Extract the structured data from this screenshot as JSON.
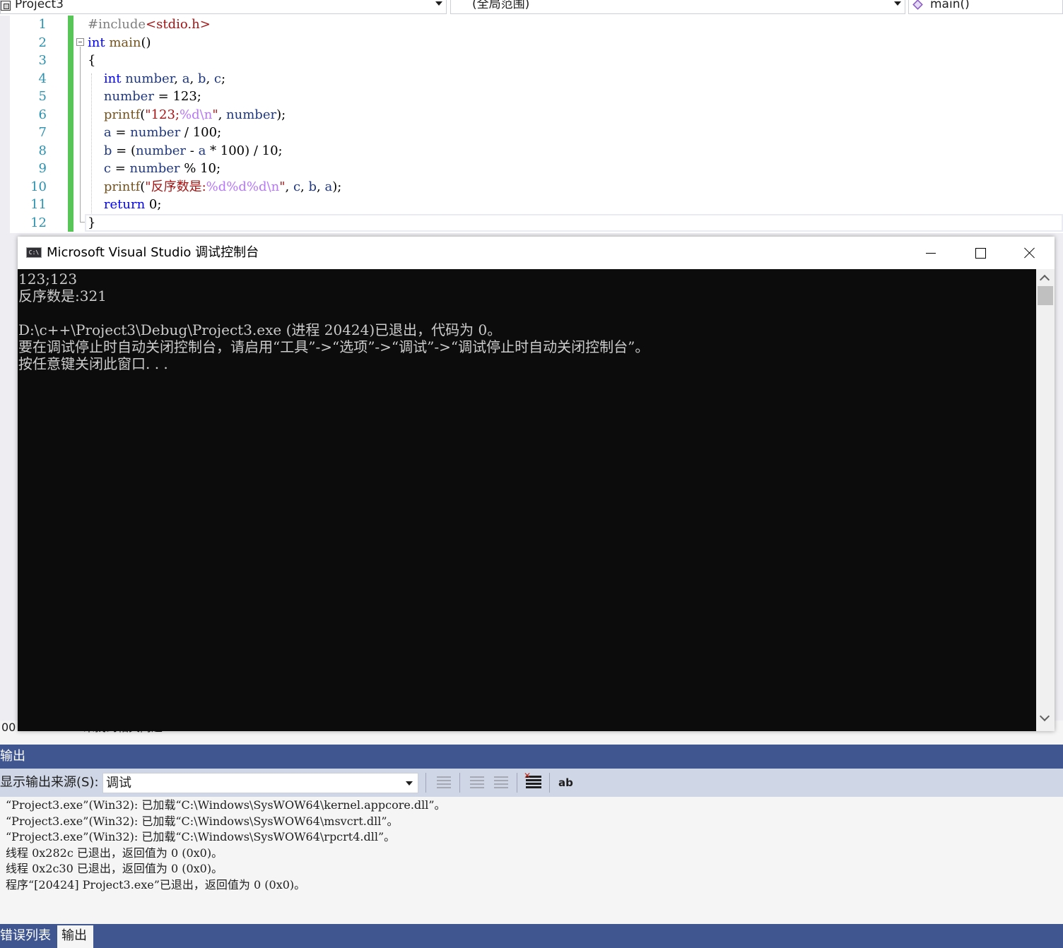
{
  "navbar": {
    "project": "Project3",
    "scope": "(全局范围)",
    "function": "main()"
  },
  "editor": {
    "line_numbers": [
      "1",
      "2",
      "3",
      "4",
      "5",
      "6",
      "7",
      "8",
      "9",
      "10",
      "11",
      "12"
    ],
    "code": {
      "l1": {
        "a": "#include",
        "b": "<stdio.h>"
      },
      "l2": {
        "a": "int",
        "b": " main",
        "c": "()"
      },
      "l3": {
        "a": "{"
      },
      "l4": {
        "a": "    int",
        "b": " number",
        "c": ", ",
        "d": "a",
        "e": ", ",
        "f": "b",
        "g": ", ",
        "h": "c",
        "i": ";"
      },
      "l5": {
        "a": "    number",
        "b": " = 123;"
      },
      "l6": {
        "a": "    printf",
        "b": "(",
        "c": "\"123;",
        "d": "%d",
        "e": "\\n",
        "f": "\"",
        "g": ", ",
        "h": "number",
        "i": ");"
      },
      "l7": {
        "a": "    a",
        "b": " = ",
        "c": "number",
        "d": " / 100;"
      },
      "l8": {
        "a": "    b",
        "b": " = (",
        "c": "number",
        "d": " - ",
        "e": "a",
        "f": " * 100) / 10;"
      },
      "l9": {
        "a": "    c",
        "b": " = ",
        "c": "number",
        "d": " % 10;"
      },
      "l10": {
        "a": "    printf",
        "b": "(",
        "c": "\"反序数是:",
        "d": "%d%d%d",
        "e": "\\n",
        "f": "\"",
        "g": ", ",
        "h": "c",
        "i": ", ",
        "j": "b",
        "k": ", ",
        "l": "a",
        "m": ");"
      },
      "l11": {
        "a": "    return",
        "b": " 0;"
      },
      "l12": {
        "a": "}"
      }
    }
  },
  "console": {
    "icon_text": "C:\\",
    "title": "Microsoft Visual Studio 调试控制台",
    "lines": [
      "123;123",
      "反序数是:321",
      "",
      "D:\\c++\\Project3\\Debug\\Project3.exe (进程 20424)已退出，代码为 0。",
      "要在调试停止时自动关闭控制台，请启用“工具”->“选项”->“调试”->“调试停止时自动关闭控制台”。",
      "按任意键关闭此窗口. . ."
    ]
  },
  "status": {
    "zoom": "00",
    "issues": "未找到相关问题"
  },
  "output": {
    "title": "输出",
    "source_label": "显示输出来源(S):",
    "source_value": "调试",
    "lines": [
      "“Project3.exe”(Win32): 已加载“C:\\Windows\\SysWOW64\\kernel.appcore.dll”。",
      "“Project3.exe”(Win32): 已加载“C:\\Windows\\SysWOW64\\msvcrt.dll”。",
      "“Project3.exe”(Win32): 已加载“C:\\Windows\\SysWOW64\\rpcrt4.dll”。",
      "线程 0x282c 已退出，返回值为 0 (0x0)。",
      "线程 0x2c30 已退出，返回值为 0 (0x0)。",
      "程序“[20424] Project3.exe”已退出，返回值为 0 (0x0)。"
    ],
    "wrap_icon_text": "ab"
  },
  "tabs": {
    "errors": "错误列表",
    "output": "输出"
  }
}
